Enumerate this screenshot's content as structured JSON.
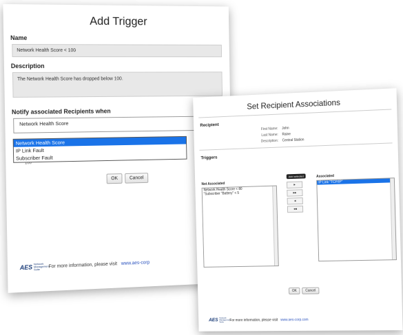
{
  "add_trigger": {
    "title": "Add Trigger",
    "name_label": "Name",
    "name_value": "Network Health Score < 100",
    "description_label": "Description",
    "description_value": "The Network Health Score has dropped below 100.",
    "notify_label": "Notify associated Recipients when",
    "select_value": "Network Health Score",
    "options": [
      "Network Health Score",
      "IP Link Fault",
      "Subscriber Fault"
    ],
    "partial_value": "100",
    "ok_label": "OK",
    "cancel_label": "Cancel",
    "footer_text": "For more information, please visit",
    "footer_link": "www.aes-corp",
    "logo_text": "AES",
    "logo_sub": "Network Management Suite"
  },
  "set_recipient": {
    "title": "Set Recipient Associations",
    "recipient_label": "Recipient",
    "fields": [
      {
        "key": "First Name:",
        "value": "John"
      },
      {
        "key": "Last Name:",
        "value": "Raine"
      },
      {
        "key": "Description:",
        "value": "Central Station"
      }
    ],
    "triggers_label": "Triggers",
    "not_associated_label": "Not Associated",
    "not_associated_items": [
      "Network Health Score < 80",
      "\"Subscriber \"Battery\" < 5"
    ],
    "associated_label": "Associated",
    "associated_items": [
      "IP Link \"TCP/IP\""
    ],
    "tooltip": "Add selected",
    "arrow_labels": [
      "▸",
      "▸▸",
      "◂",
      "◂◂"
    ],
    "ok_label": "OK",
    "cancel_label": "Cancel",
    "footer_text": "For more information, please visit",
    "footer_link": "www.aes-corp.com",
    "logo_text": "AES",
    "logo_sub": "Network Management Suite"
  },
  "colors": {
    "selection": "#1a73e8",
    "link": "#2a52be",
    "logo": "#1d3e7a"
  }
}
